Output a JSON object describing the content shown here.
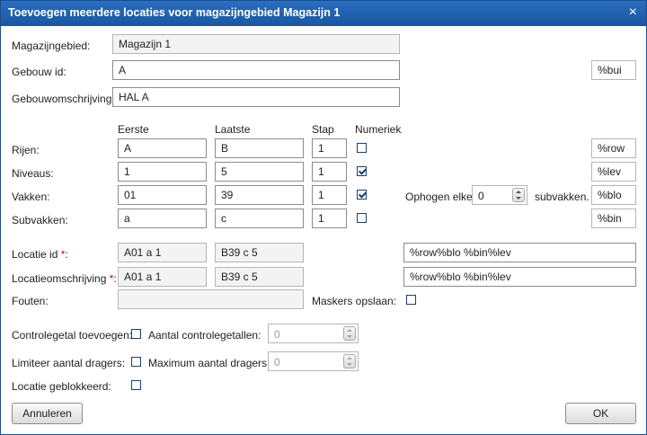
{
  "title": "Toevoegen meerdere locaties voor magazijngebied Magazijn 1",
  "close_glyph": "×",
  "top": {
    "magazijngebied_label": "Magazijngebied:",
    "magazijngebied_value": "Magazijn 1",
    "gebouw_label": "Gebouw id:",
    "gebouw_value": "A",
    "gebouw_mask": "%bui",
    "gebouwoms_label": "Gebouwomschrijving:",
    "gebouwoms_value": "HAL A"
  },
  "headers": {
    "eerste": "Eerste",
    "laatste": "Laatste",
    "stap": "Stap",
    "numeriek": "Numeriek"
  },
  "rows": [
    {
      "label": "Rijen:",
      "eerste": "A",
      "laatste": "B",
      "stap": "1",
      "numeriek": false,
      "mask": "%row"
    },
    {
      "label": "Niveaus:",
      "eerste": "1",
      "laatste": "5",
      "stap": "1",
      "numeriek": true,
      "mask": "%lev"
    },
    {
      "label": "Vakken:",
      "eerste": "01",
      "laatste": "39",
      "stap": "1",
      "numeriek": true,
      "mask": "%blo"
    },
    {
      "label": "Subvakken:",
      "eerste": "a",
      "laatste": "c",
      "stap": "1",
      "numeriek": false,
      "mask": "%bin"
    }
  ],
  "ophogen": {
    "label": "Ophogen elke",
    "value": "0",
    "suffix": "subvakken."
  },
  "locatie": {
    "id_label": "Locatie id",
    "id_first": "A01 a 1",
    "id_last": "B39 c 5",
    "id_mask": "%row%blo %bin%lev",
    "oms_label": "Locatieomschrijving",
    "oms_first": "A01 a 1",
    "oms_last": "B39 c 5",
    "oms_mask": "%row%blo %bin%lev",
    "required_mark": "*",
    "colon": ":",
    "fouten_label": "Fouten:",
    "fouten_value": "",
    "maskers_label": "Maskers opslaan:"
  },
  "options": {
    "controle_label": "Controlegetal toevoegen:",
    "aantal_controle_label": "Aantal controlegetallen:",
    "aantal_controle_value": "0",
    "limiteer_label": "Limiteer aantal dragers:",
    "max_dragers_label": "Maximum aantal dragers:",
    "max_dragers_value": "0",
    "geblokkeerd_label": "Locatie geblokkeerd:"
  },
  "buttons": {
    "cancel": "Annuleren",
    "ok": "OK"
  }
}
